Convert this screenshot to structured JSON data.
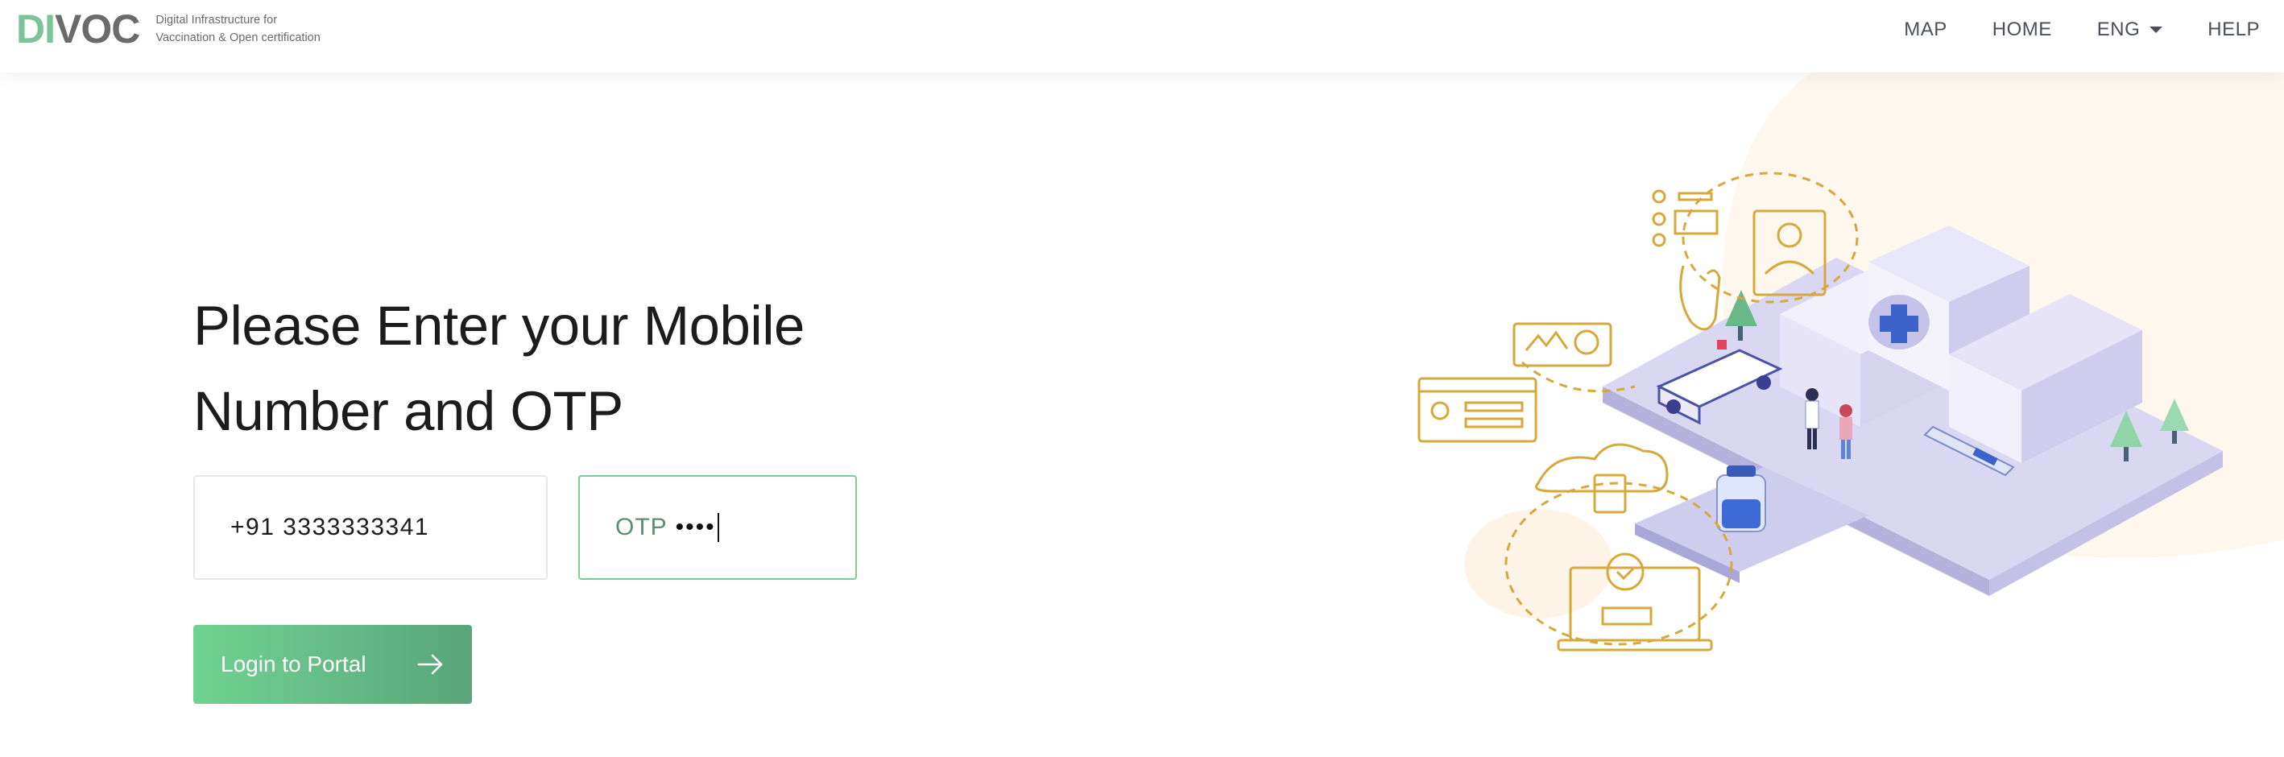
{
  "header": {
    "logo_green": "DI",
    "logo_dark": "VOC",
    "tagline_line1": "Digital Infrastructure for",
    "tagline_line2": "Vaccination & Open certification"
  },
  "nav": {
    "items": [
      {
        "label": "MAP"
      },
      {
        "label": "HOME"
      },
      {
        "label": "ENG",
        "dropdown": true
      },
      {
        "label": "HELP"
      }
    ]
  },
  "main": {
    "heading": "Please Enter your Mobile Number and OTP",
    "mobile_value": "+91 3333333341",
    "otp_placeholder": "OTP",
    "otp_masked": "••••",
    "login_label": "Login to Portal",
    "login_icon": "arrow-right-icon"
  },
  "colors": {
    "accent_green": "#7dc39a",
    "button_start": "#6fd391",
    "button_end": "#5aa57a",
    "illustration_gold": "#d7a83a",
    "illustration_lavender": "#c9c7ec"
  }
}
